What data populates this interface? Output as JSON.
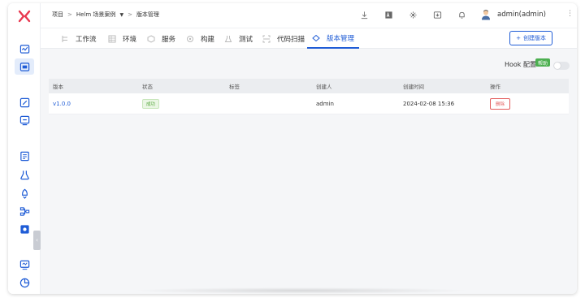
{
  "breadcrumb": {
    "root": "项目",
    "separator": ">",
    "project": "Helm 场景案例",
    "current": "版本管理"
  },
  "user": {
    "name": "admin(admin)"
  },
  "tabs": [
    {
      "label": "工作流",
      "icon": "workflow-icon"
    },
    {
      "label": "环境",
      "icon": "environment-icon"
    },
    {
      "label": "服务",
      "icon": "service-icon"
    },
    {
      "label": "构建",
      "icon": "build-icon"
    },
    {
      "label": "测试",
      "icon": "test-icon"
    },
    {
      "label": "代码扫描",
      "icon": "code-scan-icon"
    },
    {
      "label": "版本管理",
      "icon": "version-icon",
      "active": true
    }
  ],
  "create_button": {
    "label": "创建版本",
    "prefix": "+"
  },
  "hook": {
    "label": "Hook 配置",
    "help": "帮助",
    "enabled": false
  },
  "table": {
    "columns": [
      "版本",
      "状态",
      "标签",
      "创建人",
      "创建时间",
      "操作"
    ],
    "rows": [
      {
        "version": "v1.0.0",
        "status": "成功",
        "tags": "",
        "creator": "admin",
        "created_at": "2024-02-08 15:36",
        "action": "删除"
      }
    ]
  },
  "colors": {
    "accent": "#1f5cd6",
    "success": "#52a63a",
    "danger": "#e35b5b",
    "logo": "#e8384f"
  }
}
